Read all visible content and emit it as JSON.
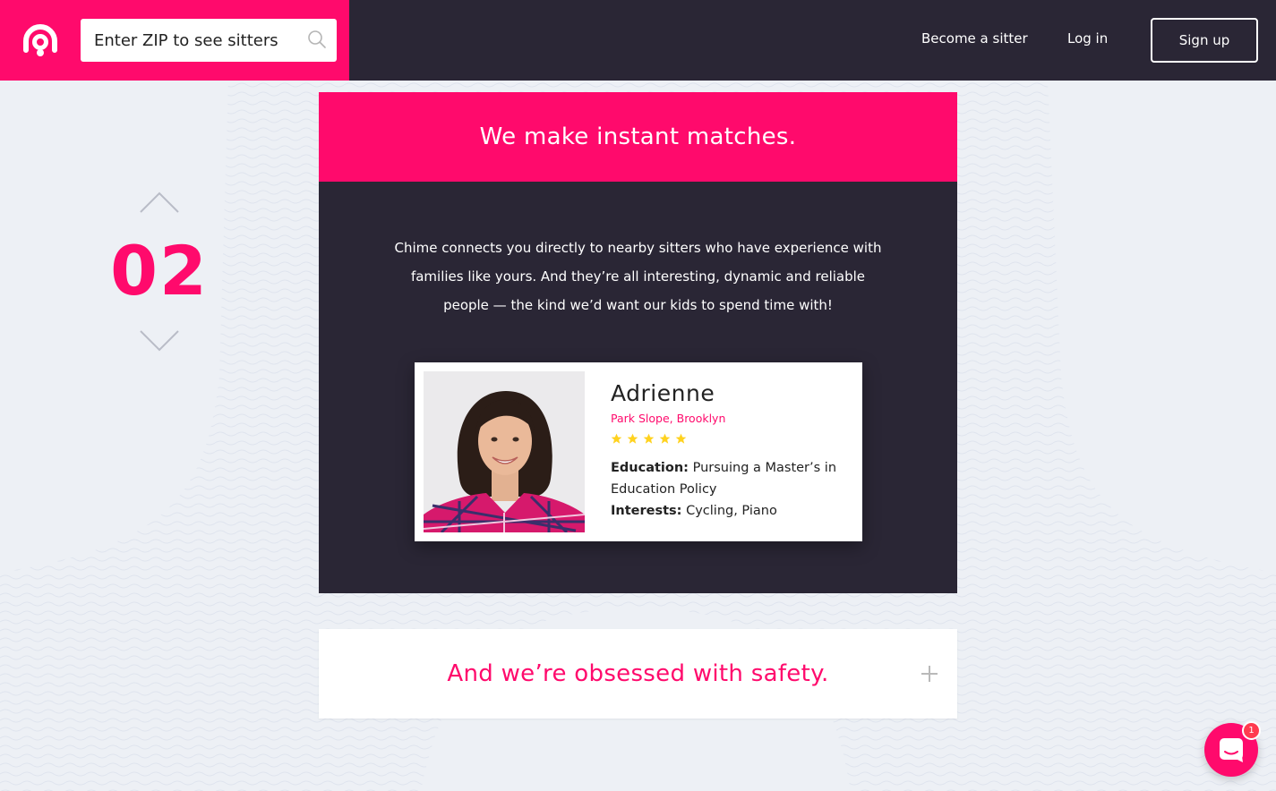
{
  "header": {
    "search_placeholder": "Enter ZIP to see sitters",
    "nav": {
      "become_sitter": "Become a sitter",
      "log_in": "Log in",
      "sign_up": "Sign up"
    }
  },
  "step": {
    "number": "02"
  },
  "match_card": {
    "title": "We make instant matches.",
    "description": "Chime connects you directly to nearby sitters who have experience with families like yours. And they’re all interesting, dynamic and reliable people — the kind we’d want our kids to spend time with!",
    "profile": {
      "name": "Adrienne",
      "location": "Park Slope, Brooklyn",
      "rating": 5,
      "rating_max": 5,
      "education_label": "Education:",
      "education_value": " Pursuing a Master’s in Education Policy",
      "interests_label": "Interests:",
      "interests_value": " Cycling, Piano"
    }
  },
  "safety_card": {
    "title": "And we’re obsessed with safety."
  },
  "chat": {
    "badge_count": "1"
  },
  "colors": {
    "brand_pink": "#ff0a6c",
    "header_dark": "#2a2635",
    "page_bg": "#edf0f5",
    "star_yellow": "#ffd21f"
  },
  "icons": {
    "logo": "chime-logo-icon",
    "search": "search-icon",
    "prev": "chevron-up-icon",
    "next": "chevron-down-icon",
    "expand": "plus-icon",
    "chat": "chat-icon"
  }
}
